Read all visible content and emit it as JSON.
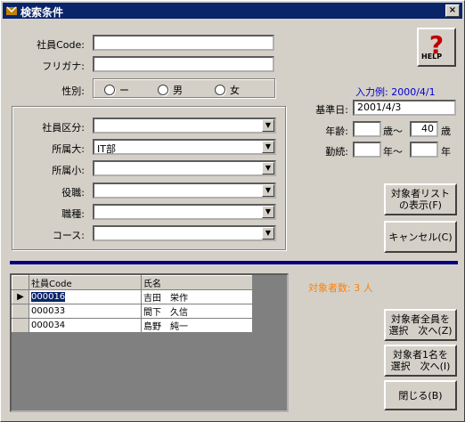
{
  "window": {
    "title": "検索条件",
    "close_label": "×"
  },
  "form": {
    "employee_code_label": "社員Code:",
    "employee_code_value": "",
    "furigana_label": "フリガナ:",
    "furigana_value": "",
    "gender_label": "性別:",
    "gender_options": [
      "ー",
      "男",
      "女"
    ],
    "division_label": "社員区分:",
    "division_value": "",
    "dept_major_label": "所属大:",
    "dept_major_value": "IT部",
    "dept_minor_label": "所属小:",
    "dept_minor_value": "",
    "position_label": "役職:",
    "position_value": "",
    "job_type_label": "職種:",
    "job_type_value": "",
    "course_label": "コース:",
    "course_value": "",
    "input_example": "入力例: 2000/4/1",
    "base_date_label": "基準日:",
    "base_date_value": "2001/4/3",
    "age_label": "年齢:",
    "age_from": "",
    "age_unit_from": "歳～",
    "age_to": "40",
    "age_unit_to": "歳",
    "tenure_label": "勤続:",
    "tenure_from": "",
    "tenure_unit_from": "年～",
    "tenure_to": "",
    "tenure_unit_to": "年"
  },
  "buttons": {
    "help": "HELP",
    "show_list_line1": "対象者リスト",
    "show_list_line2": "の表示(F)",
    "cancel": "キャンセル(C)",
    "select_all_line1": "対象者全員を",
    "select_all_line2": "選択　次へ(Z)",
    "select_one_line1": "対象者1名を",
    "select_one_line2": "選択　次へ(I)",
    "close": "閉じる(B)"
  },
  "result": {
    "count_text": "対象者数: 3 人",
    "columns": [
      "社員Code",
      "氏名"
    ],
    "rows": [
      [
        "000016",
        "吉田　栄作"
      ],
      [
        "000033",
        "間下　久信"
      ],
      [
        "000034",
        "島野　純一"
      ]
    ]
  },
  "colors": {
    "title_bar": "#0a246a",
    "hint": "#0000cc",
    "count": "#ff8000",
    "divider": "#000080"
  }
}
